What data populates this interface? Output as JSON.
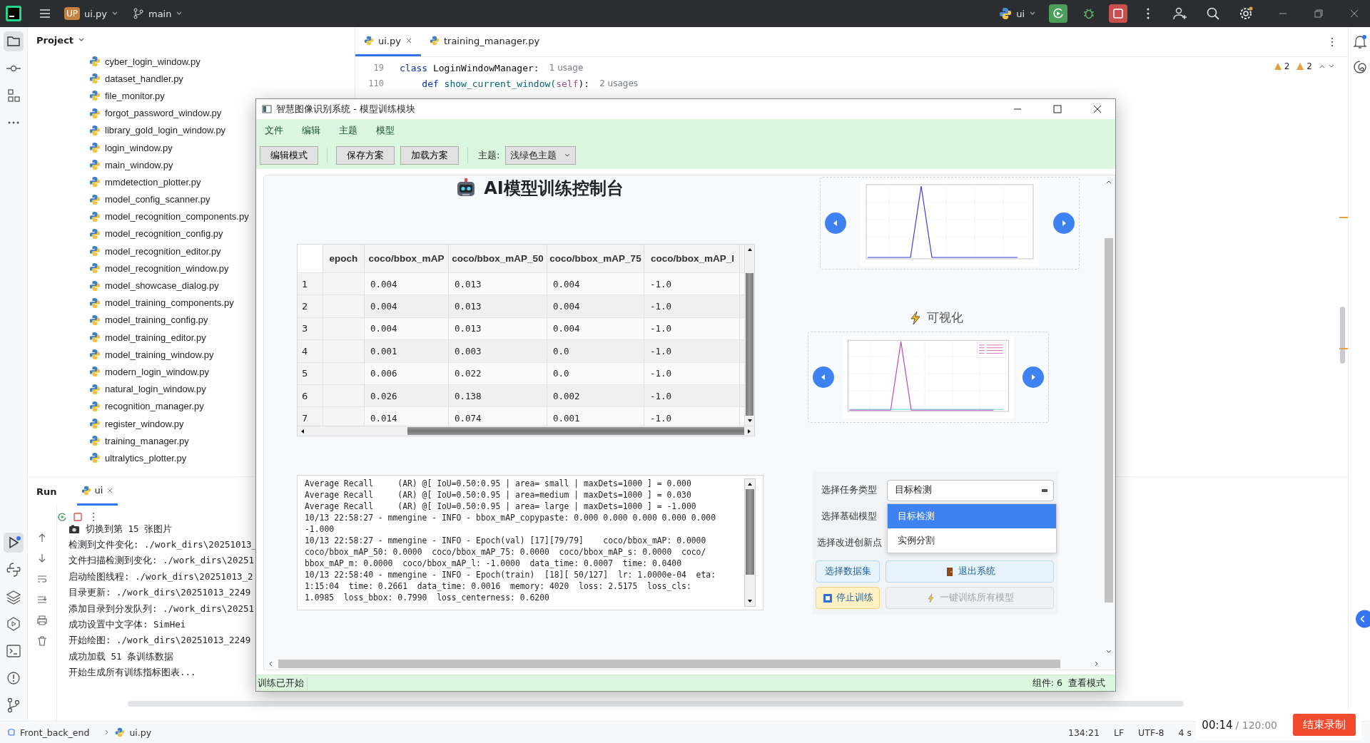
{
  "topbar": {
    "badge": "UP",
    "project": "ui.py",
    "branch": "main",
    "run_config": "ui"
  },
  "project_panel": {
    "title": "Project",
    "files": [
      "cyber_login_window.py",
      "dataset_handler.py",
      "file_monitor.py",
      "forgot_password_window.py",
      "library_gold_login_window.py",
      "login_window.py",
      "main_window.py",
      "mmdetection_plotter.py",
      "model_config_scanner.py",
      "model_recognition_components.py",
      "model_recognition_config.py",
      "model_recognition_editor.py",
      "model_recognition_window.py",
      "model_showcase_dialog.py",
      "model_training_components.py",
      "model_training_config.py",
      "model_training_editor.py",
      "model_training_window.py",
      "modern_login_window.py",
      "natural_login_window.py",
      "recognition_manager.py",
      "register_window.py",
      "training_manager.py",
      "ultralytics_plotter.py"
    ]
  },
  "editor": {
    "tabs": [
      {
        "label": "ui.py",
        "selected": true,
        "closable": true
      },
      {
        "label": "training_manager.py",
        "selected": false,
        "closable": false
      }
    ],
    "lines": [
      {
        "number": "19",
        "tokens": [
          {
            "text": "class",
            "kind": "keyword"
          },
          {
            "text": " LoginWindowManager:",
            "kind": "plain"
          }
        ],
        "hint": "1 usage"
      },
      {
        "number": "110",
        "tokens": [
          {
            "text": "    def",
            "kind": "keyword"
          },
          {
            "text": " show_current_window(",
            "kind": "function"
          },
          {
            "text": "self",
            "kind": "self"
          },
          {
            "text": "):",
            "kind": "plain"
          }
        ],
        "hint": "2 usages"
      }
    ],
    "warnings": [
      "2",
      "2"
    ]
  },
  "run_panel": {
    "title": "Run",
    "tab": "ui",
    "lines": [
      {
        "kind": "camera",
        "text": "切换到第 15 张图片"
      },
      {
        "kind": "plain",
        "text": "检测到文件变化: ./work_dirs\\20251013_"
      },
      {
        "kind": "plain",
        "text": "文件扫描检测到变化: ./work_dirs\\20251"
      },
      {
        "kind": "plain",
        "text": "启动绘图线程: ./work_dirs\\20251013_2"
      },
      {
        "kind": "plain",
        "text": "目录更新: ./work_dirs\\20251013_2249"
      },
      {
        "kind": "plain",
        "text": "添加目录到分发队列: ./work_dirs\\20251"
      },
      {
        "kind": "plain",
        "text": "成功设置中文字体: SimHei"
      },
      {
        "kind": "plain",
        "text": "开始绘图: ./work_dirs\\20251013_2249"
      },
      {
        "kind": "plain",
        "text": "成功加载 51 条训练数据"
      },
      {
        "kind": "plain",
        "text": "开始生成所有训练指标图表..."
      }
    ]
  },
  "status_bar": {
    "breadcrumbs": [
      "Front_back_end",
      "ui.py"
    ],
    "position": "134:21",
    "line_ending": "LF",
    "encoding": "UTF-8",
    "indent": "4 s"
  },
  "recorder": {
    "elapsed": "00:14",
    "limit": "/ 120:00",
    "stop_label": "结束录制"
  },
  "dialog": {
    "title": "智慧图像识别系统 - 模型训练模块",
    "menu": [
      "文件",
      "编辑",
      "主题",
      "模型"
    ],
    "toolbar": {
      "buttons": [
        "编辑模式",
        "保存方案",
        "加载方案"
      ],
      "theme_label": "主题:",
      "theme_value": "浅绿色主题"
    },
    "heading": "AI模型训练控制台",
    "table": {
      "columns": [
        "epoch",
        "coco/bbox_mAP",
        "coco/bbox_mAP_50",
        "coco/bbox_mAP_75",
        "coco/bbox_mAP_l"
      ],
      "rows": [
        {
          "index": "1",
          "cells": [
            "",
            "0.004",
            "0.013",
            "0.004",
            "-1.0"
          ]
        },
        {
          "index": "2",
          "cells": [
            "",
            "0.004",
            "0.013",
            "0.004",
            "-1.0"
          ]
        },
        {
          "index": "3",
          "cells": [
            "",
            "0.004",
            "0.013",
            "0.004",
            "-1.0"
          ]
        },
        {
          "index": "4",
          "cells": [
            "",
            "0.001",
            "0.003",
            "0.0",
            "-1.0"
          ]
        },
        {
          "index": "5",
          "cells": [
            "",
            "0.006",
            "0.022",
            "0.0",
            "-1.0"
          ]
        },
        {
          "index": "6",
          "cells": [
            "",
            "0.026",
            "0.138",
            "0.002",
            "-1.0"
          ]
        },
        {
          "index": "7",
          "cells": [
            "",
            "0.014",
            "0.074",
            "0.001",
            "-1.0"
          ]
        }
      ]
    },
    "log": [
      "Average Recall     (AR) @[ IoU=0.50:0.95 | area= small | maxDets=1000 ] = 0.000",
      "Average Recall     (AR) @[ IoU=0.50:0.95 | area=medium | maxDets=1000 ] = 0.030",
      "Average Recall     (AR) @[ IoU=0.50:0.95 | area= large | maxDets=1000 ] = -1.000",
      "10/13 22:58:27 - mmengine - INFO - bbox_mAP_copypaste: 0.000 0.000 0.000 0.000 0.000",
      "-1.000",
      "10/13 22:58:27 - mmengine - INFO - Epoch(val) [17][79/79]    coco/bbox_mAP: 0.0000",
      "coco/bbox_mAP_50: 0.0000  coco/bbox_mAP_75: 0.0000  coco/bbox_mAP_s: 0.0000  coco/",
      "bbox_mAP_m: 0.0000  coco/bbox_mAP_l: -1.0000  data_time: 0.0007  time: 0.0400",
      "10/13 22:58:40 - mmengine - INFO - Epoch(train)  [18][ 50/127]  lr: 1.0000e-04  eta:",
      "1:15:04  time: 0.2661  data_time: 0.0016  memory: 4020  loss: 2.5175  loss_cls:",
      "1.0985  loss_bbox: 0.7990  loss_centerness: 0.6200"
    ],
    "charts": [
      {
        "kind": "single"
      },
      {
        "kind": "legend"
      }
    ],
    "visual_heading": "可视化",
    "form": {
      "labels": [
        "选择任务类型",
        "选择基础模型",
        "选择改进创新点"
      ],
      "task_value": "目标检测",
      "options": [
        {
          "label": "目标检测",
          "selected": true
        },
        {
          "label": "实例分割",
          "selected": false
        }
      ]
    },
    "buttons": [
      {
        "label": "选择数据集",
        "kind": "dataset",
        "disabled": false
      },
      {
        "label": "退出系统",
        "kind": "exit",
        "disabled": false
      },
      {
        "label": "停止训练",
        "kind": "stop",
        "disabled": false
      },
      {
        "label": "一键训练所有模型",
        "kind": "train_all",
        "disabled": true
      }
    ],
    "status": {
      "left": "训练已开始",
      "components": "组件: 6",
      "mode": "查看模式"
    }
  }
}
